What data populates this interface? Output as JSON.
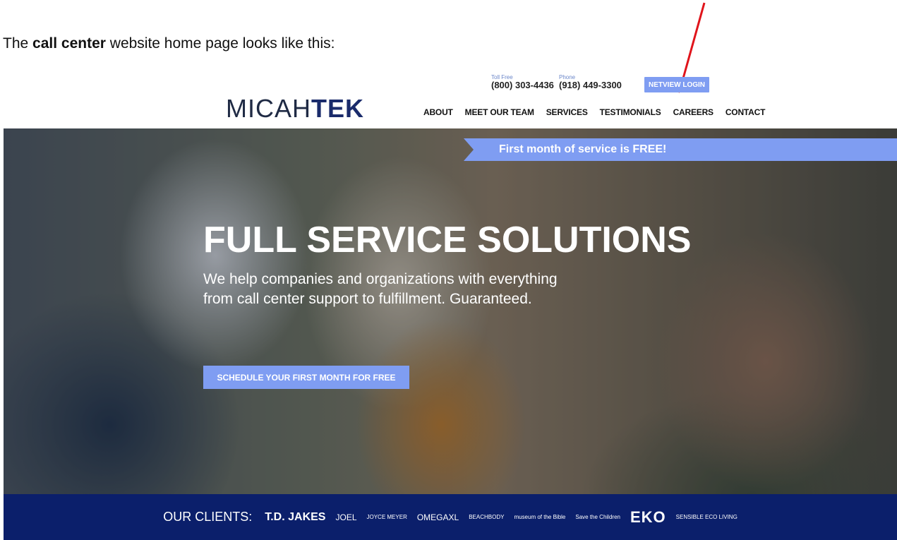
{
  "caption": {
    "prefix": "The ",
    "bold": "call center",
    "suffix": " website home page looks like this:"
  },
  "header": {
    "logo_thin": "MICAH",
    "logo_bold": "TEK",
    "tollfree_label": "Toll Free",
    "tollfree_number": "(800) 303-4436",
    "phone_label": "Phone",
    "phone_number": "(918) 449-3300",
    "login_label": "NETVIEW LOGIN"
  },
  "nav": [
    "ABOUT",
    "MEET OUR TEAM",
    "SERVICES",
    "TESTIMONIALS",
    "CAREERS",
    "CONTACT"
  ],
  "hero": {
    "promo": "First month of service is FREE!",
    "title": "FULL SERVICE SOLUTIONS",
    "subtitle": "We help companies and organizations with everything from call center support to fulfillment. Guaranteed.",
    "cta": "SCHEDULE YOUR FIRST MONTH FOR FREE"
  },
  "clients": {
    "label": "OUR CLIENTS:",
    "logos": [
      "T.D. JAKES",
      "JOEL",
      "JOYCE MEYER",
      "OMEGAXL",
      "BEACHBODY",
      "museum of the Bible",
      "Save the Children",
      "EKO",
      "SENSIBLE ECO LIVING"
    ]
  },
  "colors": {
    "accent": "#7f9df2",
    "navy": "#0b1f6b",
    "arrow": "#e0141b"
  }
}
